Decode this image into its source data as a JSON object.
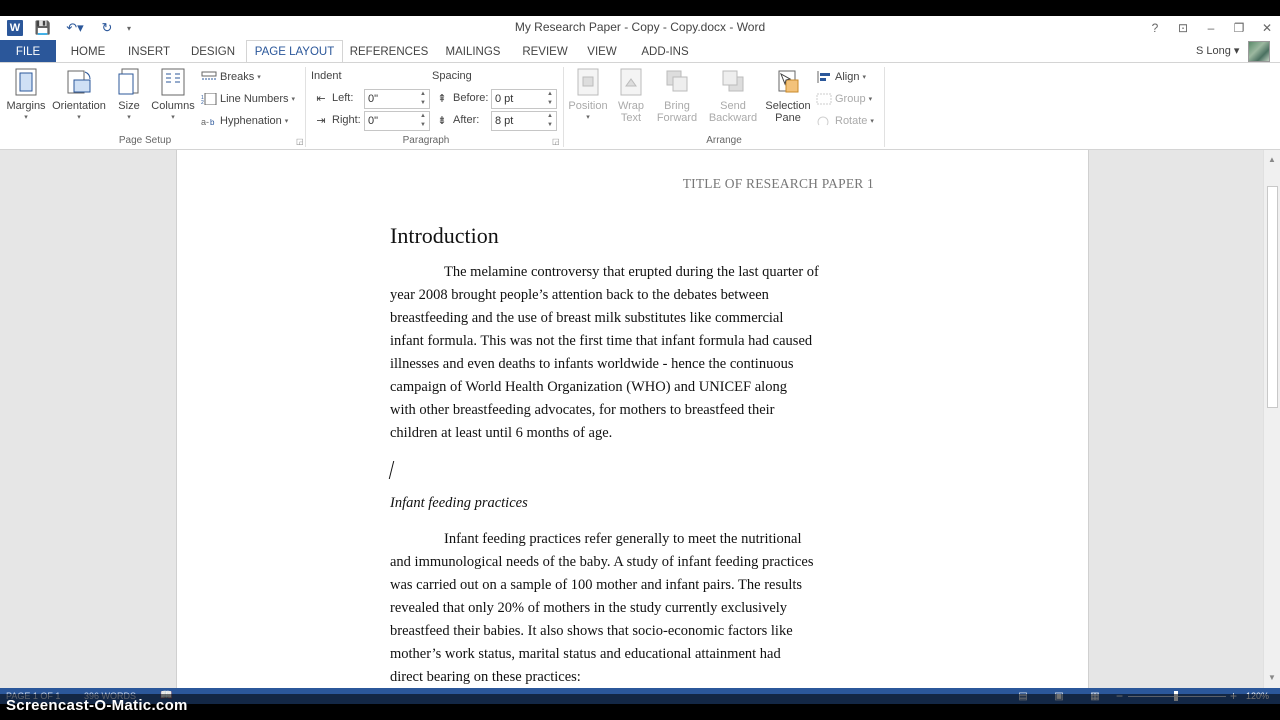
{
  "window": {
    "title": "My Research Paper - Copy - Copy.docx - Word",
    "help": "?",
    "ribbon_display": "⊡",
    "minimize": "–",
    "restore": "❐",
    "close": "✕"
  },
  "qat": {
    "logo_letter": "W",
    "save_icon": "💾",
    "undo_icon": "↶▾",
    "redo_icon": "↻",
    "customize": "▾"
  },
  "tabs": [
    {
      "label": "FILE"
    },
    {
      "label": "HOME"
    },
    {
      "label": "INSERT"
    },
    {
      "label": "DESIGN"
    },
    {
      "label": "PAGE LAYOUT"
    },
    {
      "label": "REFERENCES"
    },
    {
      "label": "MAILINGS"
    },
    {
      "label": "REVIEW"
    },
    {
      "label": "VIEW"
    },
    {
      "label": "ADD-INS"
    }
  ],
  "user": {
    "name": "S Long ▾"
  },
  "ribbon": {
    "page_setup": {
      "margins": "Margins",
      "orientation": "Orientation",
      "size": "Size",
      "columns": "Columns",
      "breaks": "Breaks",
      "line_numbers": "Line Numbers",
      "hyphenation": "Hyphenation",
      "group_label": "Page Setup"
    },
    "paragraph": {
      "indent_label": "Indent",
      "spacing_label": "Spacing",
      "left_label": "Left:",
      "right_label": "Right:",
      "before_label": "Before:",
      "after_label": "After:",
      "left_value": "0\"",
      "right_value": "0\"",
      "before_value": "0 pt",
      "after_value": "8 pt",
      "group_label": "Paragraph"
    },
    "arrange": {
      "position_1": "Position",
      "wrap_1": "Wrap",
      "wrap_2": "Text",
      "bring_1": "Bring",
      "bring_2": "Forward",
      "send_1": "Send",
      "send_2": "Backward",
      "selection_1": "Selection",
      "selection_2": "Pane",
      "align": "Align",
      "group": "Group",
      "rotate": "Rotate",
      "group_label": "Arrange"
    }
  },
  "document": {
    "header": "TITLE OF RESEARCH PAPER 1",
    "heading": "Introduction",
    "para1": [
      "The melamine controversy that erupted during the last quarter of",
      "year 2008 brought people’s attention back to the debates between",
      "breastfeeding and the use of breast milk substitutes like commercial",
      "infant formula. This was not the first time that infant formula had caused",
      "illnesses and even deaths to infants worldwide - hence the continuous",
      "campaign of World Health Organization (WHO) and UNICEF along",
      "with other breastfeeding advocates, for mothers to breastfeed their",
      "children at least until 6 months of age."
    ],
    "subheading": "Infant feeding practices",
    "para2": [
      "Infant feeding practices refer generally to meet the nutritional",
      "and immunological needs of the baby. A study of infant feeding practices",
      "was carried out on a sample of 100 mother and infant pairs. The results",
      "revealed that only 20% of mothers in the study currently exclusively",
      "breastfeed their babies. It also shows that socio-economic factors like",
      "mother’s work status, marital status and educational attainment had",
      "direct bearing on these practices:"
    ]
  },
  "status": {
    "page": "PAGE 1 OF 1",
    "words": "396 WORDS",
    "proofing": "📖",
    "zoom": "120%",
    "zoom_percent": 120
  },
  "watermark": {
    "text": "Screencast-O-Matic.com"
  },
  "colors": {
    "accent": "#2b579a"
  }
}
